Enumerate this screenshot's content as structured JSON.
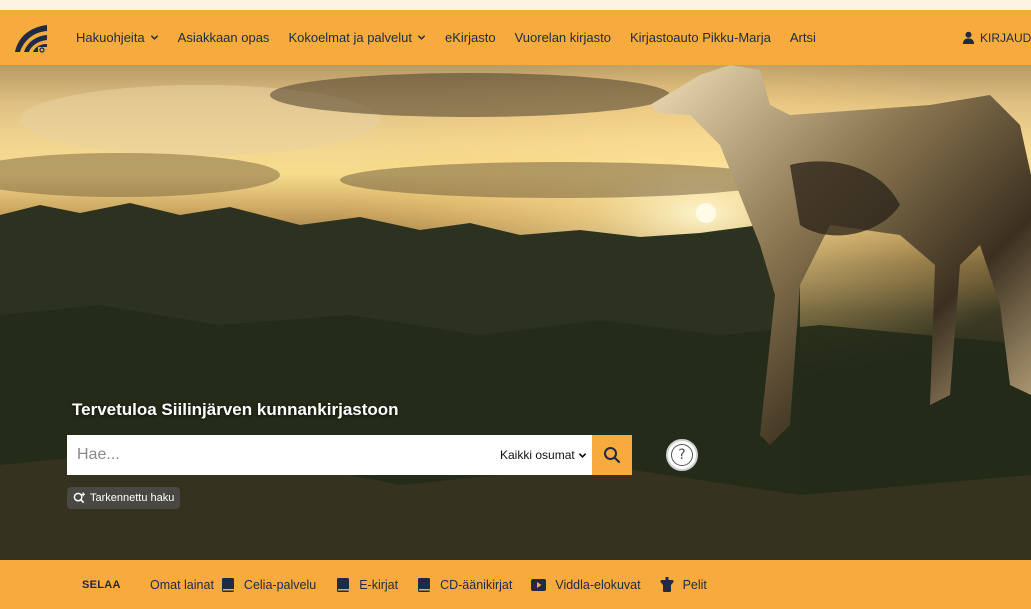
{
  "nav": {
    "items": [
      {
        "label": "Hakuohjeita",
        "dropdown": true
      },
      {
        "label": "Asiakkaan opas",
        "dropdown": false
      },
      {
        "label": "Kokoelmat ja palvelut",
        "dropdown": true
      },
      {
        "label": "eKirjasto",
        "dropdown": false
      },
      {
        "label": "Vuorelan kirjasto",
        "dropdown": false
      },
      {
        "label": "Kirjastoauto Pikku-Marja",
        "dropdown": false
      },
      {
        "label": "Artsi",
        "dropdown": false
      }
    ],
    "login_label": "KIRJAUDU"
  },
  "hero": {
    "welcome": "Tervetuloa Siilinjärven kunnankirjastoon"
  },
  "search": {
    "placeholder": "Hae...",
    "scope_label": "Kaikki osumat",
    "help_symbol": "?",
    "advanced_label": "Tarkennettu haku"
  },
  "browse": {
    "title": "SELAA",
    "items": [
      {
        "label": "Omat lainat",
        "icon": "none"
      },
      {
        "label": "Celia-palvelu",
        "icon": "book-icon"
      },
      {
        "label": "E-kirjat",
        "icon": "book-icon"
      },
      {
        "label": "CD-äänikirjat",
        "icon": "book-icon"
      },
      {
        "label": "Viddla-elokuvat",
        "icon": "video-icon"
      },
      {
        "label": "Pelit",
        "icon": "game-icon"
      }
    ]
  },
  "colors": {
    "accent": "#f7ab3c",
    "nav_text": "#1f2a44"
  }
}
